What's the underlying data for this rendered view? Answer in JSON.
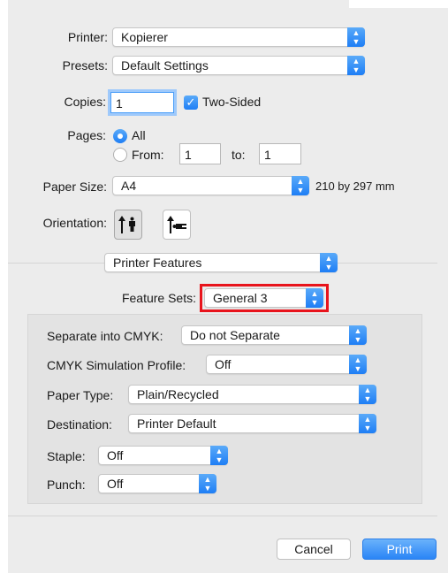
{
  "printer": {
    "label": "Printer:",
    "value": "Kopierer"
  },
  "presets": {
    "label": "Presets:",
    "value": "Default Settings"
  },
  "copies": {
    "label": "Copies:",
    "value": "1"
  },
  "two_sided": {
    "label": "Two-Sided",
    "checked": true
  },
  "pages": {
    "label": "Pages:",
    "all_label": "All",
    "from_label": "From:",
    "from_value": "1",
    "to_label": "to:",
    "to_value": "1"
  },
  "paper_size": {
    "label": "Paper Size:",
    "value": "A4",
    "dimensions": "210 by 297 mm"
  },
  "orientation": {
    "label": "Orientation:",
    "selected": "portrait"
  },
  "section": {
    "value": "Printer Features"
  },
  "feature_sets": {
    "label": "Feature Sets:",
    "value": "General 3"
  },
  "features": {
    "separate": {
      "label": "Separate into CMYK:",
      "value": "Do not Separate"
    },
    "cmyk_profile": {
      "label": "CMYK Simulation Profile:",
      "value": "Off"
    },
    "paper_type": {
      "label": "Paper Type:",
      "value": "Plain/Recycled"
    },
    "destination": {
      "label": "Destination:",
      "value": "Printer Default"
    },
    "staple": {
      "label": "Staple:",
      "value": "Off"
    },
    "punch": {
      "label": "Punch:",
      "value": "Off"
    }
  },
  "buttons": {
    "cancel": "Cancel",
    "print": "Print"
  },
  "colors": {
    "accent": "#1e7ef5",
    "highlight": "#e8141c"
  }
}
